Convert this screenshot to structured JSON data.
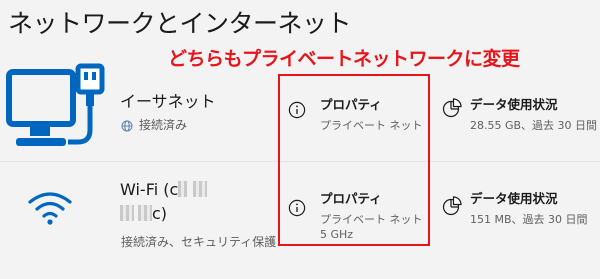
{
  "page": {
    "title": "ネットワークとインターネット"
  },
  "annotation": {
    "text": "どちらもプライベートネットワークに変更",
    "color": "#e8141b"
  },
  "networks": [
    {
      "name": "イーサネット",
      "status": "接続済み",
      "icon": "monitor-ethernet-icon",
      "properties": {
        "label": "プロパティ",
        "sub": "プライベート ネットワーク"
      },
      "usage": {
        "label": "データ使用状況",
        "sub": "28.55 GB、過去 30 日間"
      }
    },
    {
      "name_start": "Wi-Fi (c",
      "name_end": "c)",
      "status": "接続済み、セキュリティ保護あり",
      "icon": "wifi-icon",
      "properties": {
        "label": "プロパティ",
        "sub": "プライベート ネットワーク",
        "sub2": "5 GHz"
      },
      "usage": {
        "label": "データ使用状況",
        "sub": "151 MB、過去 30 日間"
      }
    }
  ],
  "colors": {
    "accent": "#0067c0",
    "highlight": "#e8141b"
  }
}
